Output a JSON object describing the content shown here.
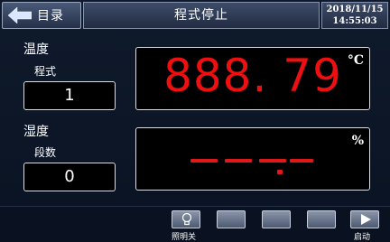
{
  "header": {
    "back_label": "目录",
    "title": "程式停止",
    "date": "2018/11/15",
    "time": "14:55:03"
  },
  "left": {
    "temperature_label": "温度",
    "program_label": "程式",
    "program_value": "1",
    "humidity_label": "湿度",
    "segment_label": "段数",
    "segment_value": "0"
  },
  "temperature_panel": {
    "value": "888. 79",
    "unit": "°C",
    "color": "#ee1010"
  },
  "humidity_panel": {
    "unit": "%",
    "value_shown": "dashes"
  },
  "footer": {
    "light_label": "照明关",
    "start_label": "启动",
    "light_icon": "lightbulb-icon",
    "start_icon": "play-icon"
  }
}
